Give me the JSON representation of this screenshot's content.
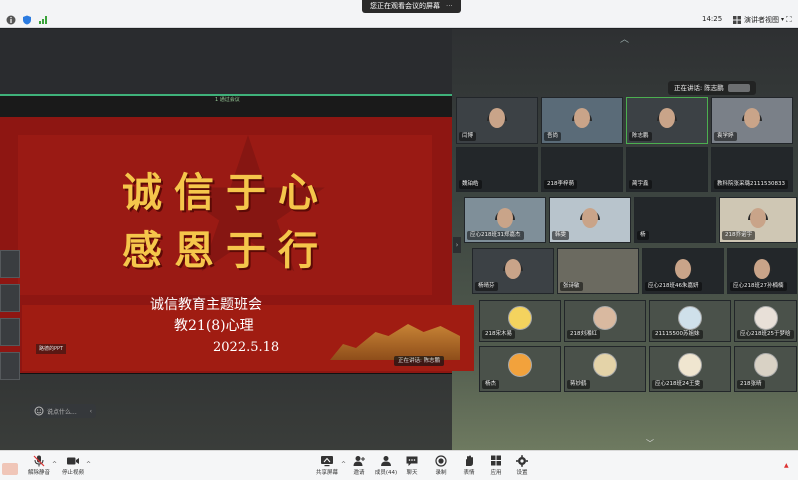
{
  "topbar": {
    "share_banner": "您正在观看会议的屏幕",
    "clock": "14:25",
    "view_label": "演讲者视图"
  },
  "stage": {
    "speaking_label": "正在讲话: 陈志鹏",
    "slide_top_label": "1 通过会议",
    "slide_title_line1": "诚信于心",
    "slide_title_line2": "感恩于行",
    "slide_subtitle_line1": "诚信教育主题班会",
    "slide_subtitle_line2": "教21(8)心理",
    "slide_date": "2022.5.18",
    "slide_speaker_tag": "正在讲话: 陈志鹏",
    "slide_left_tag": "路德的PPT"
  },
  "chat": {
    "placeholder": "说点什么..."
  },
  "participants": [
    {
      "name": "闫博"
    },
    {
      "name": "吾尚"
    },
    {
      "name": "陈志鹏"
    },
    {
      "name": "袁学婷"
    },
    {
      "name": "魏铂皓"
    },
    {
      "name": "218李梓萌"
    },
    {
      "name": "蔺宇鑫"
    },
    {
      "name": "教科院张采璐2111530833"
    },
    {
      "name": "应心218班31郑嘉杰"
    },
    {
      "name": "韩雯"
    },
    {
      "name": "杨"
    },
    {
      "name": "218乔诺宇"
    },
    {
      "name": "杨晴芬"
    },
    {
      "name": "张诗敏"
    },
    {
      "name": "应心218班46朱嘉妍"
    },
    {
      "name": "应心218班27孙楠楠"
    },
    {
      "name": "218宋木易"
    },
    {
      "name": "218刘湘红"
    },
    {
      "name": "21115500苏姐妹"
    },
    {
      "name": "应心218班25于梦晗"
    },
    {
      "name": "杨杰"
    },
    {
      "name": "蒋妙鹤"
    },
    {
      "name": "应心218班24王雯"
    },
    {
      "name": "218张晴"
    }
  ],
  "toolbar": {
    "mute_label": "解除静音",
    "video_label": "停止视频",
    "share_label": "共享屏幕",
    "invite_label": "邀请",
    "members_label": "成员(44)",
    "chat_label": "聊天",
    "record_label": "录制",
    "reaction_label": "表情",
    "apps_label": "应用",
    "settings_label": "设置"
  }
}
